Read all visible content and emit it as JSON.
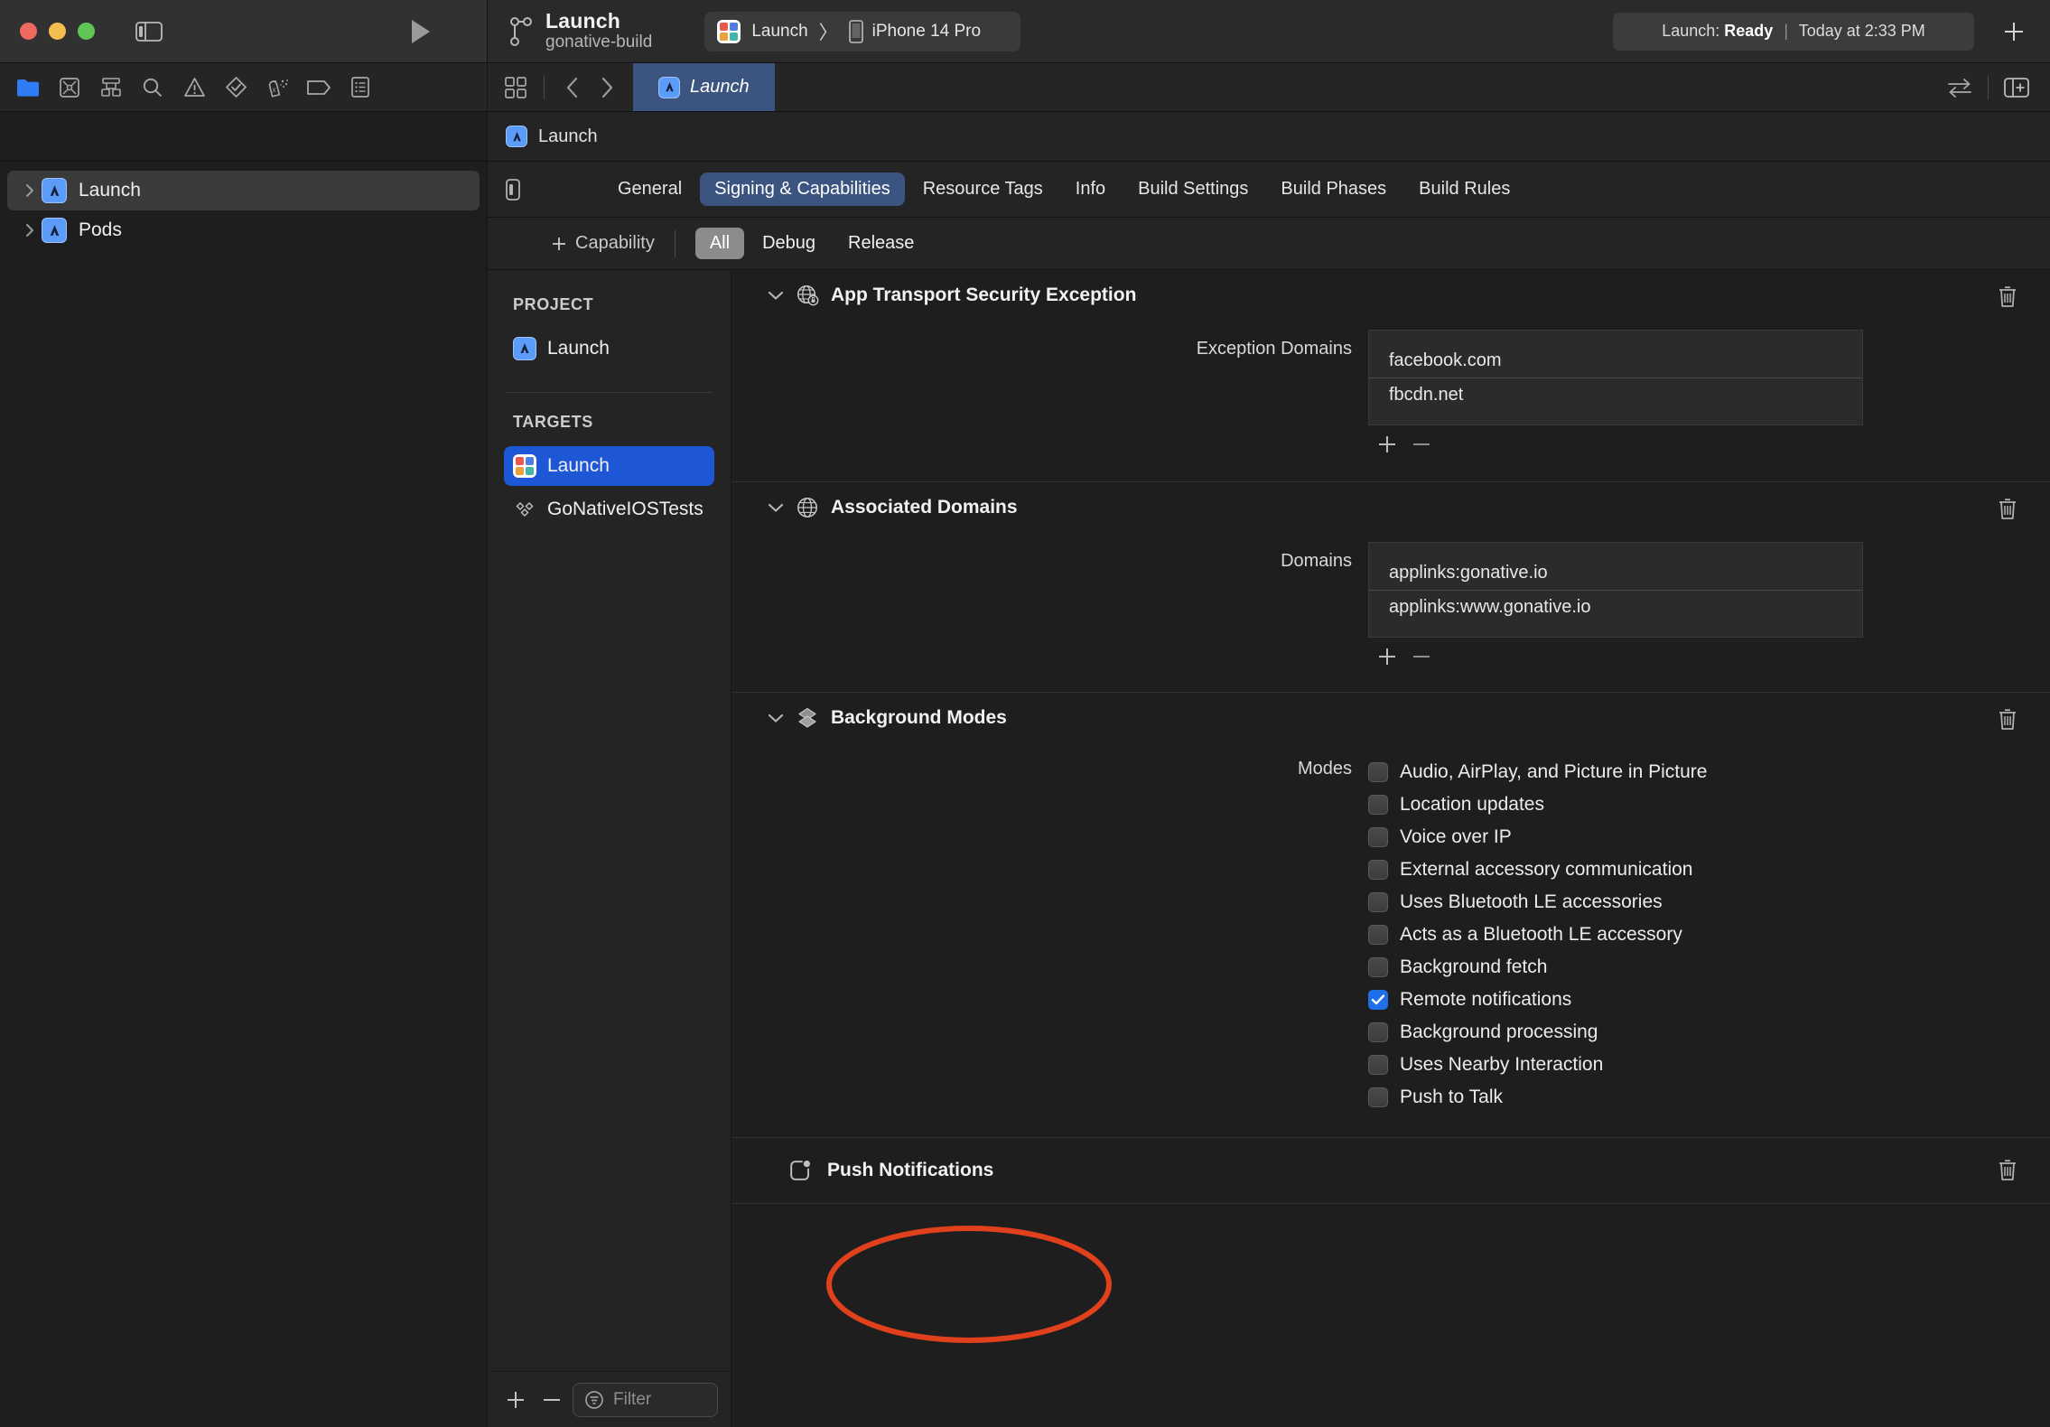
{
  "window": {
    "titlebar": {
      "project_title": "Launch",
      "project_subtitle": "gonative-build",
      "scheme_name": "Launch",
      "scheme_chevron": "〉",
      "destination_name": "iPhone 14 Pro",
      "status_prefix": "Launch:",
      "status_state": "Ready",
      "status_separator": "|",
      "status_time": "Today at 2:33 PM",
      "add_button_icon": "plus-icon",
      "run_button_icon": "run-play-icon",
      "sidebar_toggle_icon": "sidebar-toggle-icon"
    }
  },
  "navigator_toolbar": {
    "icons": [
      {
        "name": "project-navigator-icon",
        "label": "Project"
      },
      {
        "name": "source-control-navigator-icon",
        "label": "Source Control"
      },
      {
        "name": "symbol-navigator-icon",
        "label": "Symbols"
      },
      {
        "name": "find-navigator-icon",
        "label": "Find"
      },
      {
        "name": "issue-navigator-icon",
        "label": "Issues"
      },
      {
        "name": "test-navigator-icon",
        "label": "Tests"
      },
      {
        "name": "debug-navigator-icon",
        "label": "Debug"
      },
      {
        "name": "breakpoint-navigator-icon",
        "label": "Breakpoints"
      },
      {
        "name": "report-navigator-icon",
        "label": "Reports"
      }
    ]
  },
  "navigator": {
    "items": [
      {
        "label": "Launch",
        "icon": "xcodeproj-icon",
        "selected": true,
        "expanded": false
      },
      {
        "label": "Pods",
        "icon": "xcodeproj-icon",
        "selected": false,
        "expanded": false
      }
    ]
  },
  "editor_toolbar": {
    "grid_icon": "editor-grid-icon",
    "back_icon": "chevron-left-icon",
    "forward_icon": "chevron-right-icon",
    "tab_label": "Launch",
    "tab_icon": "xcodeproj-icon",
    "swap_icon": "swap-arrows-icon",
    "add_editor_icon": "add-editor-icon"
  },
  "breadcrumb": {
    "icon": "xcodeproj-icon",
    "label": "Launch"
  },
  "project_editor": {
    "inspector_toggle_icon": "inspector-toggle-icon",
    "tabs": [
      {
        "label": "General",
        "active": false
      },
      {
        "label": "Signing & Capabilities",
        "active": true
      },
      {
        "label": "Resource Tags",
        "active": false
      },
      {
        "label": "Info",
        "active": false
      },
      {
        "label": "Build Settings",
        "active": false
      },
      {
        "label": "Build Phases",
        "active": false
      },
      {
        "label": "Build Rules",
        "active": false
      }
    ],
    "capability_bar": {
      "add_icon": "plus-icon",
      "add_label": "Capability",
      "segments": [
        {
          "label": "All",
          "active": true
        },
        {
          "label": "Debug",
          "active": false
        },
        {
          "label": "Release",
          "active": false
        }
      ]
    },
    "sidebar": {
      "project_heading": "PROJECT",
      "projects": [
        {
          "label": "Launch",
          "icon": "xcodeproj-icon",
          "selected": false
        }
      ],
      "targets_heading": "TARGETS",
      "targets": [
        {
          "label": "Launch",
          "icon": "app-target-icon",
          "selected": true
        },
        {
          "label": "GoNativeIOSTests",
          "icon": "test-target-icon",
          "selected": false
        }
      ],
      "filter": {
        "add_icon": "plus-icon",
        "remove_icon": "minus-icon",
        "filter_icon": "filter-icon",
        "placeholder": "Filter",
        "value": ""
      }
    },
    "capabilities": [
      {
        "title": "App Transport Security Exception",
        "icon": "globe-lock-icon",
        "chevron": "chevron-down-icon",
        "delete_icon": "trash-icon",
        "field_label": "Exception Domains",
        "values": [
          "facebook.com",
          "fbcdn.net"
        ],
        "add_icon": "plus-icon",
        "remove_icon": "minus-icon"
      },
      {
        "title": "Associated Domains",
        "icon": "globe-icon",
        "chevron": "chevron-down-icon",
        "delete_icon": "trash-icon",
        "field_label": "Domains",
        "values": [
          "applinks:gonative.io",
          "applinks:www.gonative.io"
        ],
        "add_icon": "plus-icon",
        "remove_icon": "minus-icon"
      }
    ],
    "background_modes": {
      "title": "Background Modes",
      "icon": "background-modes-icon",
      "chevron": "chevron-down-icon",
      "delete_icon": "trash-icon",
      "field_label": "Modes",
      "modes": [
        {
          "label": "Audio, AirPlay, and Picture in Picture",
          "checked": false
        },
        {
          "label": "Location updates",
          "checked": false
        },
        {
          "label": "Voice over IP",
          "checked": false
        },
        {
          "label": "External accessory communication",
          "checked": false
        },
        {
          "label": "Uses Bluetooth LE accessories",
          "checked": false
        },
        {
          "label": "Acts as a Bluetooth LE accessory",
          "checked": false
        },
        {
          "label": "Background fetch",
          "checked": false
        },
        {
          "label": "Remote notifications",
          "checked": true
        },
        {
          "label": "Background processing",
          "checked": false
        },
        {
          "label": "Uses Nearby Interaction",
          "checked": false
        },
        {
          "label": "Push to Talk",
          "checked": false
        }
      ]
    },
    "push_notifications": {
      "title": "Push Notifications",
      "icon": "push-notifications-icon",
      "delete_icon": "trash-icon"
    }
  },
  "annotation": {
    "shape": "ellipse",
    "color": "#e0401c",
    "target": "Push Notifications"
  },
  "colors": {
    "window_bg": "#1e1e1e",
    "titlebar_bg": "#2a2a2a",
    "panel_bg": "#242424",
    "accent_blue": "#1e57d6",
    "tab_active_blue": "#3b5480",
    "checkbox_checked": "#1e6fe8",
    "annotation_red": "#e0401c",
    "folder_blue": "#2f7cf6"
  }
}
